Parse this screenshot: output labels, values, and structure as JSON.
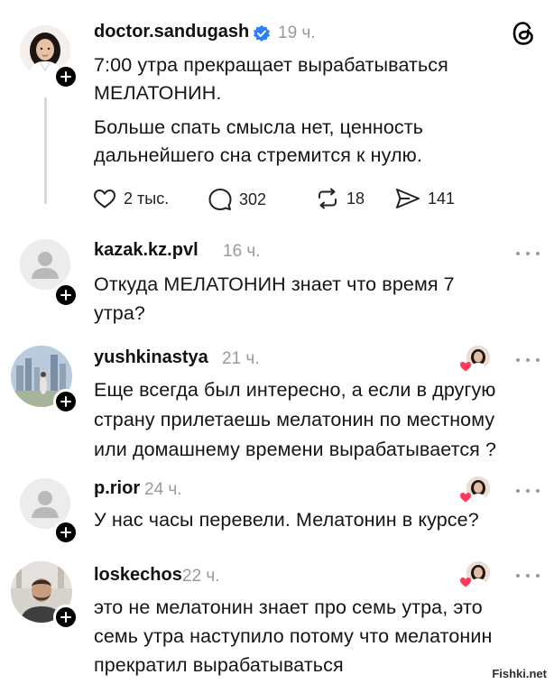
{
  "colors": {
    "verified": "#2a7fff",
    "like_heart": "#ff3b5c",
    "muted": "#9a9a9a"
  },
  "posts": [
    {
      "username": "doctor.sandugash",
      "verified": true,
      "time": "19 ч.",
      "lines": [
        "7:00 утра прекращает вырабатываться",
        "МЕЛАТОНИН.",
        "Больше спать смысла нет, ценность",
        "дальнейшего сна стремится к нулю."
      ],
      "actions": {
        "likes": "2 тыс.",
        "comments": "302",
        "reposts": "18",
        "shares": "141"
      },
      "icons": [
        "threads-logo-icon",
        "heart-icon",
        "comment-icon",
        "repost-icon",
        "share-icon"
      ]
    },
    {
      "username": "kazak.kz.pvl",
      "time": "16 ч.",
      "lines": [
        "Откуда МЕЛАТОНИН  знает что время 7",
        "утра?"
      ]
    },
    {
      "username": "yushkinastya",
      "time": "21 ч.",
      "lines": [
        "Еще всегда был интересно, а если в другую",
        "страну прилетаешь мелатонин по местному",
        "или домашнему времени вырабатывается ?"
      ]
    },
    {
      "username": "p.rior",
      "time": "24 ч.",
      "lines": [
        "У нас часы перевели. Мелатонин в курсе?"
      ]
    },
    {
      "username": "loskechos",
      "time": "22 ч.",
      "lines": [
        "это не мелатонин знает про семь утра, это",
        "семь утра наступило потому что мелатонин",
        "прекратил вырабатываться"
      ]
    }
  ],
  "watermark": "Fishki.net"
}
